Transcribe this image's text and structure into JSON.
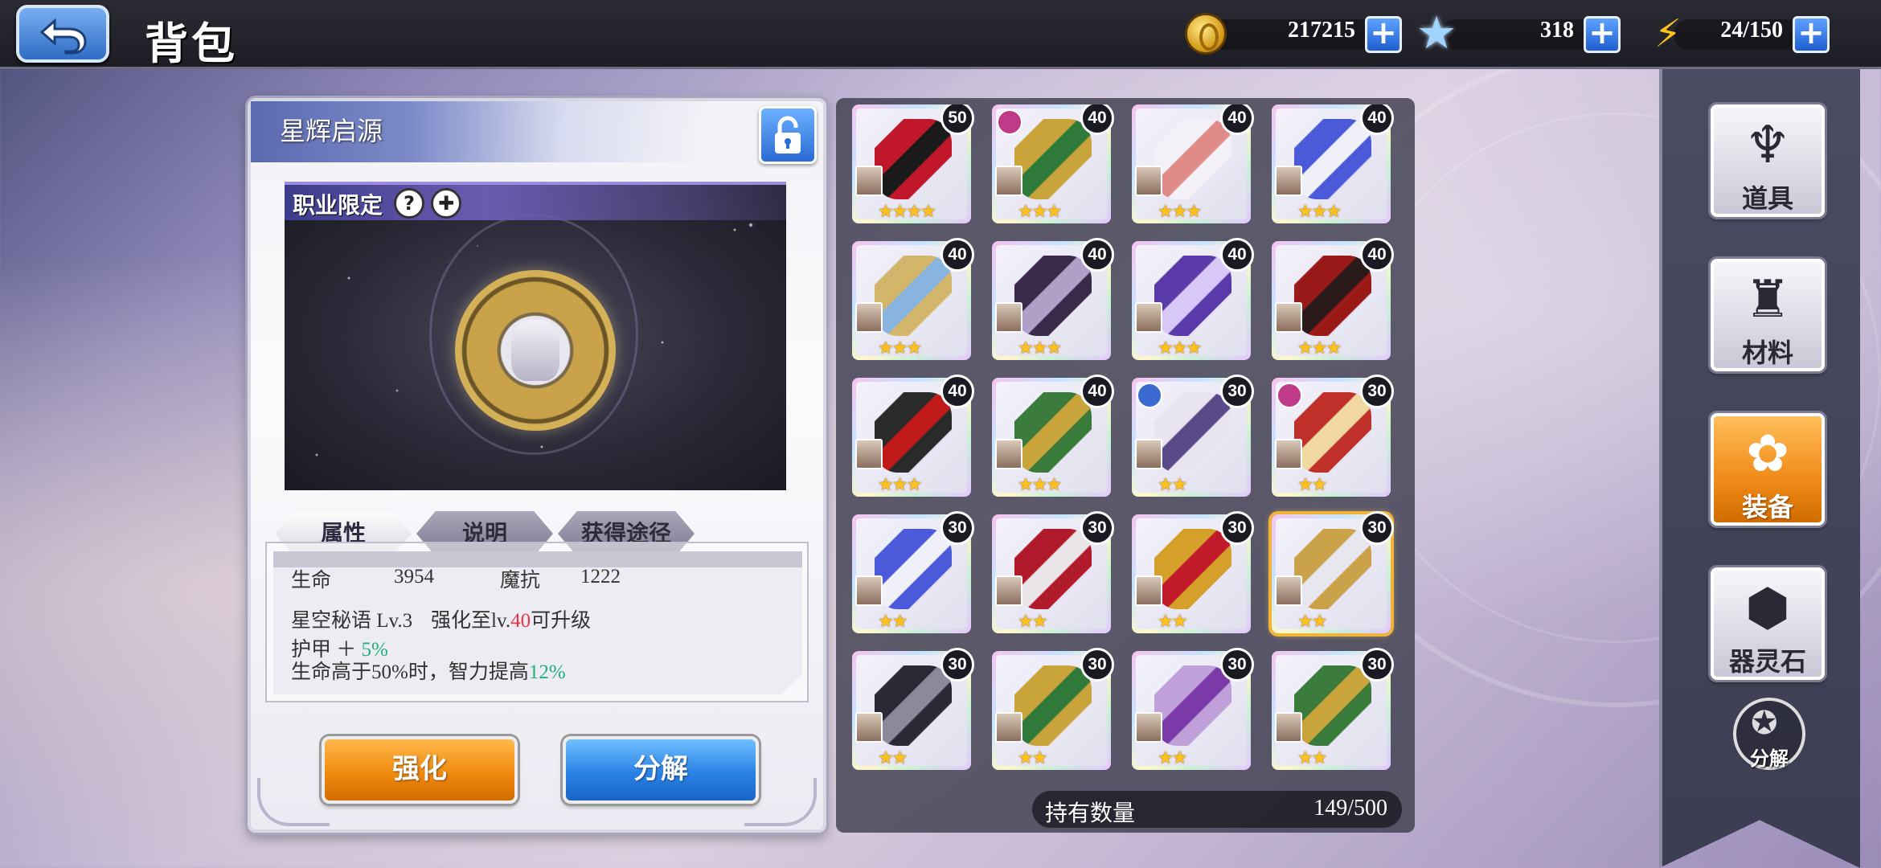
{
  "header": {
    "title": "背包",
    "resources": [
      {
        "icon": "gold-coin-icon",
        "value": "217215"
      },
      {
        "icon": "star-crystal-icon",
        "value": "318"
      },
      {
        "icon": "lightning-stamina-icon",
        "value": "24/150"
      }
    ]
  },
  "detail": {
    "item_name": "星辉启源",
    "class_restriction_label": "职业限定",
    "tabs": [
      "属性",
      "说明",
      "获得途径"
    ],
    "stats": {
      "hp_label": "生命",
      "hp_value": "3954",
      "mres_label": "魔抗",
      "mres_value": "1222"
    },
    "skill_name": "星空秘语 Lv.3",
    "upgrade_prefix": "强化至lv.",
    "upgrade_level": "40",
    "upgrade_suffix": "可升级",
    "effect1_prefix": "护甲 ＋ ",
    "effect1_value": "5%",
    "effect2_prefix": "生命高于50%时，智力提高",
    "effect2_value": "12%",
    "enhance_label": "强化",
    "decompose_label": "分解"
  },
  "inventory": {
    "items": [
      {
        "level": "50",
        "stars": 4,
        "art": "scythe",
        "badge": ""
      },
      {
        "level": "40",
        "stars": 3,
        "art": "green-staff",
        "badge": "pink"
      },
      {
        "level": "40",
        "stars": 3,
        "art": "swan-vase",
        "badge": ""
      },
      {
        "level": "40",
        "stars": 3,
        "art": "blue-vase",
        "badge": ""
      },
      {
        "level": "40",
        "stars": 3,
        "art": "gauntlet",
        "badge": ""
      },
      {
        "level": "40",
        "stars": 3,
        "art": "chain",
        "badge": ""
      },
      {
        "level": "40",
        "stars": 3,
        "art": "purple-blade",
        "badge": ""
      },
      {
        "level": "40",
        "stars": 3,
        "art": "red-sword",
        "badge": ""
      },
      {
        "level": "40",
        "stars": 3,
        "art": "spear",
        "badge": ""
      },
      {
        "level": "40",
        "stars": 3,
        "art": "serpent-staff",
        "badge": ""
      },
      {
        "level": "30",
        "stars": 2,
        "art": "white-robe",
        "badge": "blue"
      },
      {
        "level": "30",
        "stars": 2,
        "art": "red-robe",
        "badge": "pink"
      },
      {
        "level": "30",
        "stars": 2,
        "art": "blue-vase",
        "badge": ""
      },
      {
        "level": "30",
        "stars": 2,
        "art": "red-helm",
        "badge": ""
      },
      {
        "level": "30",
        "stars": 2,
        "art": "crown",
        "badge": ""
      },
      {
        "level": "30",
        "stars": 2,
        "art": "sun-emblem",
        "badge": "",
        "selected": true
      },
      {
        "level": "30",
        "stars": 2,
        "art": "dark-wings",
        "badge": ""
      },
      {
        "level": "30",
        "stars": 2,
        "art": "green-staff",
        "badge": ""
      },
      {
        "level": "30",
        "stars": 2,
        "art": "wand",
        "badge": ""
      },
      {
        "level": "30",
        "stars": 2,
        "art": "serpent-staff",
        "badge": ""
      }
    ],
    "count_label": "持有数量",
    "count_value": "149/500"
  },
  "sidebar": {
    "tabs": [
      {
        "label": "道具",
        "icon": "props-icon",
        "active": false
      },
      {
        "label": "材料",
        "icon": "material-crystal-icon",
        "active": false
      },
      {
        "label": "装备",
        "icon": "equipment-lily-icon",
        "active": true
      },
      {
        "label": "器灵石",
        "icon": "spirit-stone-icon",
        "active": false
      }
    ],
    "decompose_label": "分解"
  },
  "colors": {
    "accent_orange": "#f08a10",
    "accent_blue": "#2b82e6",
    "highlight_red": "#e8334a",
    "highlight_green": "#22b07a",
    "star": "#ffc21c"
  }
}
